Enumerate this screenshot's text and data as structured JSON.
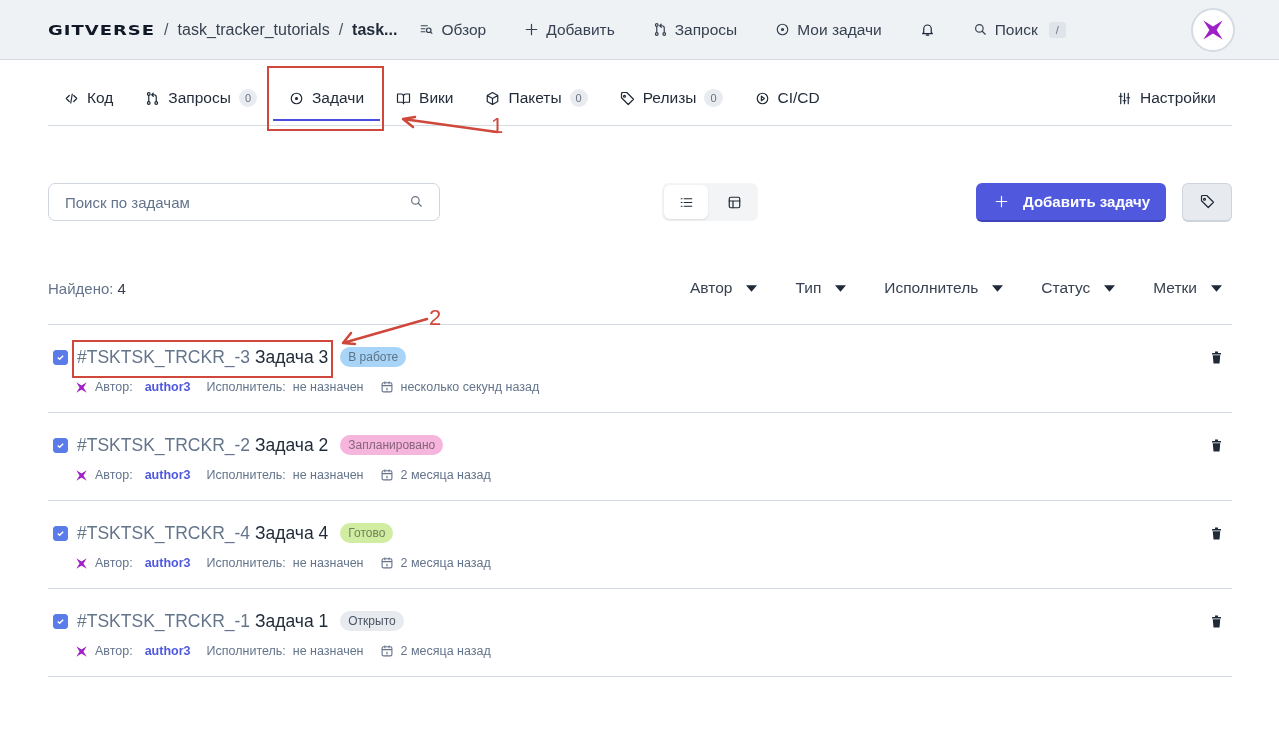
{
  "header": {
    "logo": "GITVERSE",
    "breadcrumbs": [
      {
        "separator": "/",
        "label": "task_tracker_tutorials",
        "current": false
      },
      {
        "separator": "/",
        "label": "task...",
        "current": true
      }
    ],
    "nav": [
      {
        "kind": "overview",
        "label": "Обзор"
      },
      {
        "kind": "add",
        "label": "Добавить"
      },
      {
        "kind": "requests",
        "label": "Запросы"
      },
      {
        "kind": "issues",
        "label": "Мои задачи"
      }
    ],
    "search": {
      "label": "Поиск",
      "shortcut": "/"
    }
  },
  "tabs": [
    {
      "kind": "code",
      "label": "Код",
      "selected": false
    },
    {
      "kind": "requests",
      "label": "Запросы",
      "count": "0",
      "selected": false
    },
    {
      "kind": "issues",
      "label": "Задачи",
      "selected": true,
      "callout": "1"
    },
    {
      "kind": "wiki",
      "label": "Вики",
      "selected": false
    },
    {
      "kind": "packages",
      "label": "Пакеты",
      "count": "0",
      "selected": false
    },
    {
      "kind": "releases",
      "label": "Релизы",
      "count": "0",
      "selected": false
    },
    {
      "kind": "cicd",
      "label": "CI/CD",
      "selected": false
    }
  ],
  "settings": "Настройки",
  "toolbar": {
    "search_placeholder": "Поиск по задачам",
    "views": [
      {
        "kind": "list",
        "selected": true
      },
      {
        "kind": "grid",
        "selected": false
      }
    ],
    "add_button": "Добавить задачу"
  },
  "found": {
    "label": "Найдено:",
    "count": "4"
  },
  "filters": [
    "Автор",
    "Тип",
    "Исполнитель",
    "Статус",
    "Метки"
  ],
  "issues": [
    {
      "id": "#TSKTSK_TRCKR_-3",
      "title": "Задача 3",
      "checked": true,
      "status": {
        "label": "В работе",
        "color": "#a8d4f7"
      },
      "author_label": "Автор:",
      "author": "author3",
      "assignee_label": "Исполнитель:",
      "assignee": "не назначен",
      "date": "несколько секунд назад",
      "callout": "2"
    },
    {
      "id": "#TSKTSK_TRCKR_-2",
      "title": "Задача 2",
      "checked": true,
      "status": {
        "label": "Запланировано",
        "color": "#f5b5dd"
      },
      "author_label": "Автор:",
      "author": "author3",
      "assignee_label": "Исполнитель:",
      "assignee": "не назначен",
      "date": "2 месяца назад"
    },
    {
      "id": "#TSKTSK_TRCKR_-4",
      "title": "Задача 4",
      "checked": true,
      "status": {
        "label": "Готово",
        "color": "#d0eda2"
      },
      "author_label": "Автор:",
      "author": "author3",
      "assignee_label": "Исполнитель:",
      "assignee": "не назначен",
      "date": "2 месяца назад"
    },
    {
      "id": "#TSKTSK_TRCKR_-1",
      "title": "Задача 1",
      "checked": true,
      "status": {
        "label": "Открыто",
        "color": "#e7eaee"
      },
      "author_label": "Автор:",
      "author": "author3",
      "assignee_label": "Исполнитель:",
      "assignee": "не назначен",
      "date": "2 месяца назад"
    }
  ]
}
